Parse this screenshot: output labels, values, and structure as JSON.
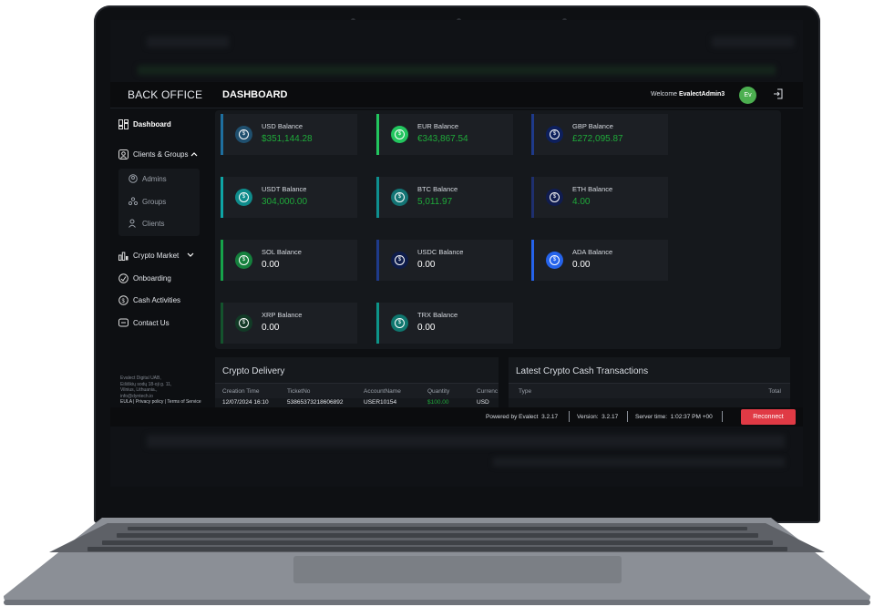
{
  "header": {
    "brand": "BACK OFFICE",
    "page_title": "DASHBOARD",
    "welcome_prefix": "Welcome ",
    "username": "EvalectAdmin3",
    "avatar_initials": "Ev"
  },
  "sidebar": {
    "items": [
      {
        "label": "Dashboard",
        "icon": "dashboard-icon"
      },
      {
        "label": "Clients & Groups",
        "icon": "user-circle-icon"
      },
      {
        "label": "Crypto Market",
        "icon": "market-icon"
      },
      {
        "label": "Onboarding",
        "icon": "onboarding-icon"
      },
      {
        "label": "Cash Activities",
        "icon": "cash-icon"
      },
      {
        "label": "Contact Us",
        "icon": "message-icon"
      }
    ],
    "subitems": [
      {
        "label": "Admins",
        "icon": "admin-icon"
      },
      {
        "label": "Groups",
        "icon": "groups-icon"
      },
      {
        "label": "Clients",
        "icon": "clients-icon"
      }
    ],
    "footer": {
      "company": "Evalect Digital UAB,",
      "address1": "Eišiškių sodų 18-oji g. 11,",
      "address2": "Vilnius, Lithuania.,",
      "email": "info@dyntech.io",
      "links": "EULA | Privacy policy | Terms of Service"
    }
  },
  "balances": [
    {
      "label": "USD Balance",
      "value": "$351,144.28",
      "accent": "#1e6f9f",
      "icon_bg": "#1f4f6e",
      "value_color": "#1faa3a"
    },
    {
      "label": "EUR Balance",
      "value": "€343,867.54",
      "accent": "#22c55e",
      "icon_bg": "#22c55e",
      "value_color": "#1faa3a"
    },
    {
      "label": "GBP Balance",
      "value": "£272,095.87",
      "accent": "#1e3a8a",
      "icon_bg": "#0d1f5c",
      "value_color": "#1faa3a"
    },
    {
      "label": "USDT Balance",
      "value": "304,000.00",
      "accent": "#0ea5a5",
      "icon_bg": "#0f8c8c",
      "value_color": "#1faa3a"
    },
    {
      "label": "BTC Balance",
      "value": "5,011.97",
      "accent": "#0e8f8f",
      "icon_bg": "#137474",
      "value_color": "#1faa3a"
    },
    {
      "label": "ETH Balance",
      "value": "4.00",
      "accent": "#1e2f6e",
      "icon_bg": "#101c4f",
      "value_color": "#1faa3a"
    },
    {
      "label": "SOL Balance",
      "value": "0.00",
      "accent": "#16a34a",
      "icon_bg": "#15803d",
      "value_color": "#ffffff"
    },
    {
      "label": "USDC Balance",
      "value": "0.00",
      "accent": "#1e3a8a",
      "icon_bg": "#0e1c4a",
      "value_color": "#ffffff"
    },
    {
      "label": "ADA Balance",
      "value": "0.00",
      "accent": "#2563eb",
      "icon_bg": "#2563eb",
      "value_color": "#ffffff"
    },
    {
      "label": "XRP Balance",
      "value": "0.00",
      "accent": "#14532d",
      "icon_bg": "#123a26",
      "value_color": "#ffffff"
    },
    {
      "label": "TRX Balance",
      "value": "0.00",
      "accent": "#0d9488",
      "icon_bg": "#0f766e",
      "value_color": "#ffffff"
    }
  ],
  "crypto_delivery": {
    "title": "Crypto Delivery",
    "columns": [
      "Creation Time",
      "TicketNo",
      "AccountName",
      "Quantity",
      "Currenc"
    ],
    "row": [
      "12/07/2024 16:10",
      "53865373218606892",
      "USER10154",
      "$100.00",
      "USD"
    ]
  },
  "transactions": {
    "title": "Latest Crypto Cash Transactions",
    "columns": [
      "Type",
      "Total"
    ]
  },
  "status": {
    "powered": "Powered by Evalect",
    "powered_version": "3.2.17",
    "version_label": "Version:",
    "version": "3.2.17",
    "server_label": "Server time:",
    "server_time": "1:02:37 PM +00",
    "reconnect": "Reconnect"
  }
}
